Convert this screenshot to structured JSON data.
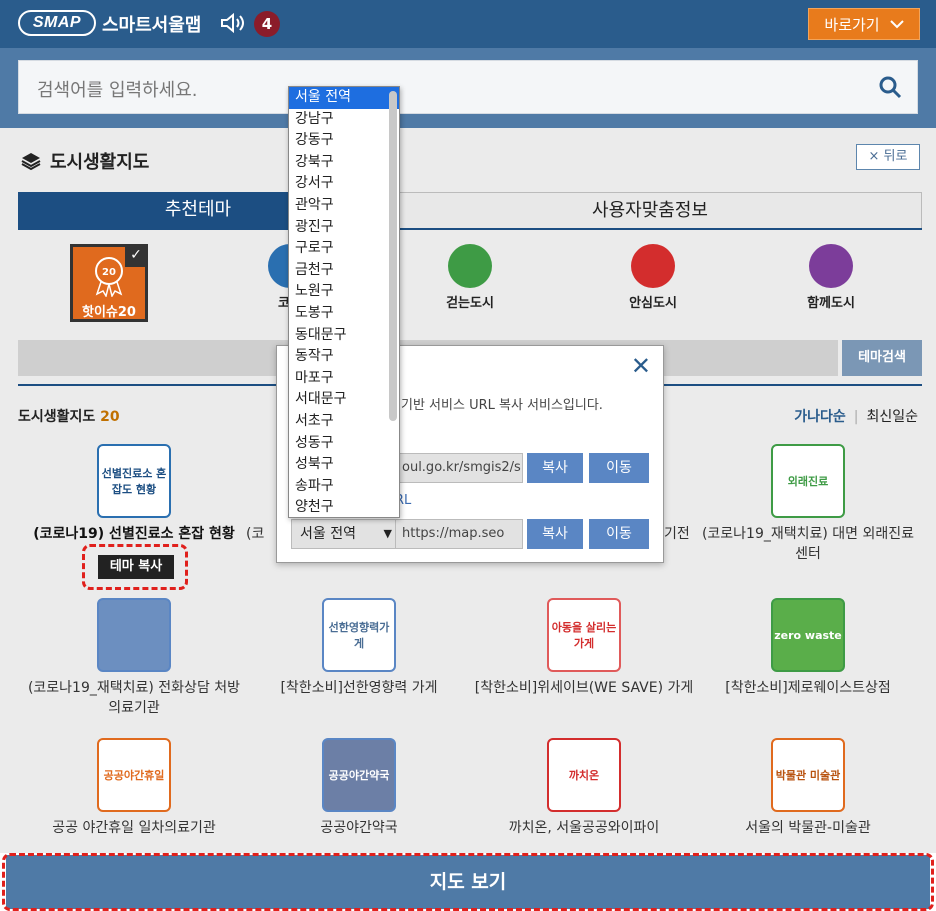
{
  "header": {
    "logo": "SMAP",
    "title": "스마트서울맵",
    "badge": "4",
    "goto_label": "바로가기"
  },
  "search": {
    "placeholder": "검색어를 입력하세요."
  },
  "section": {
    "title": "도시생활지도",
    "back_label": "× 뒤로"
  },
  "tabs": [
    {
      "label": "추천테마"
    },
    {
      "label": "사용자맞춤정보"
    }
  ],
  "themes": [
    {
      "label": "핫이슈20",
      "color": "#e06a1e"
    },
    {
      "label": "코로나19",
      "color": "#2a6fb0"
    },
    {
      "label": "걷는도시",
      "color": "#3e9b45"
    },
    {
      "label": "안심도시",
      "color": "#d32d2d"
    },
    {
      "label": "함께도시",
      "color": "#7c3d9a"
    }
  ],
  "theme_search_label": "테마검색",
  "list": {
    "title": "도시생활지도",
    "count": "20",
    "sort_a": "가나다순",
    "sort_b": "최신일순"
  },
  "cards": [
    {
      "label": "(코로나19) 선별진료소 혼잡 현황",
      "icon_text": "선별진료소 혼잡도 현황"
    },
    {
      "label": "(코",
      "icon_text": ""
    },
    {
      "label": "기전",
      "icon_text": ""
    },
    {
      "label": "(코로나19_재택치료) 대면 외래진료 센터",
      "icon_text": "외래진료"
    },
    {
      "label": "(코로나19_재택치료) 전화상담 처방 의료기관",
      "icon_text": ""
    },
    {
      "label": "[착한소비]선한영향력 가게",
      "icon_text": "선한영향력가게"
    },
    {
      "label": "[착한소비]위세이브(WE SAVE) 가게",
      "icon_text": "아동을 살리는 가게"
    },
    {
      "label": "[착한소비]제로웨이스트상점",
      "icon_text": "zero waste"
    },
    {
      "label": "공공 야간휴일 일차의료기관",
      "icon_text": "공공야간휴일"
    },
    {
      "label": "공공야간약국",
      "icon_text": "공공야간약국"
    },
    {
      "label": "까치온, 서울공공와이파이",
      "icon_text": "까치온"
    },
    {
      "label": "서울의 박물관-미술관",
      "icon_text": "박물관 미술관"
    }
  ],
  "copy_theme_label": "테마 복사",
  "map_button_label": "지도 보기",
  "modal": {
    "desc": "기반 서비스 URL 복사 서비스입니다.",
    "url1": "oul.go.kr/smgis2/s",
    "url2": "https://map.seo",
    "copy_label": "복사",
    "move_label": "이동",
    "rl_label": "RL",
    "select_value": "서울 전역"
  },
  "dropdown": {
    "options": [
      "서울 전역",
      "강남구",
      "강동구",
      "강북구",
      "강서구",
      "관악구",
      "광진구",
      "구로구",
      "금천구",
      "노원구",
      "도봉구",
      "동대문구",
      "동작구",
      "마포구",
      "서대문구",
      "서초구",
      "성동구",
      "성북구",
      "송파구",
      "양천구"
    ]
  }
}
